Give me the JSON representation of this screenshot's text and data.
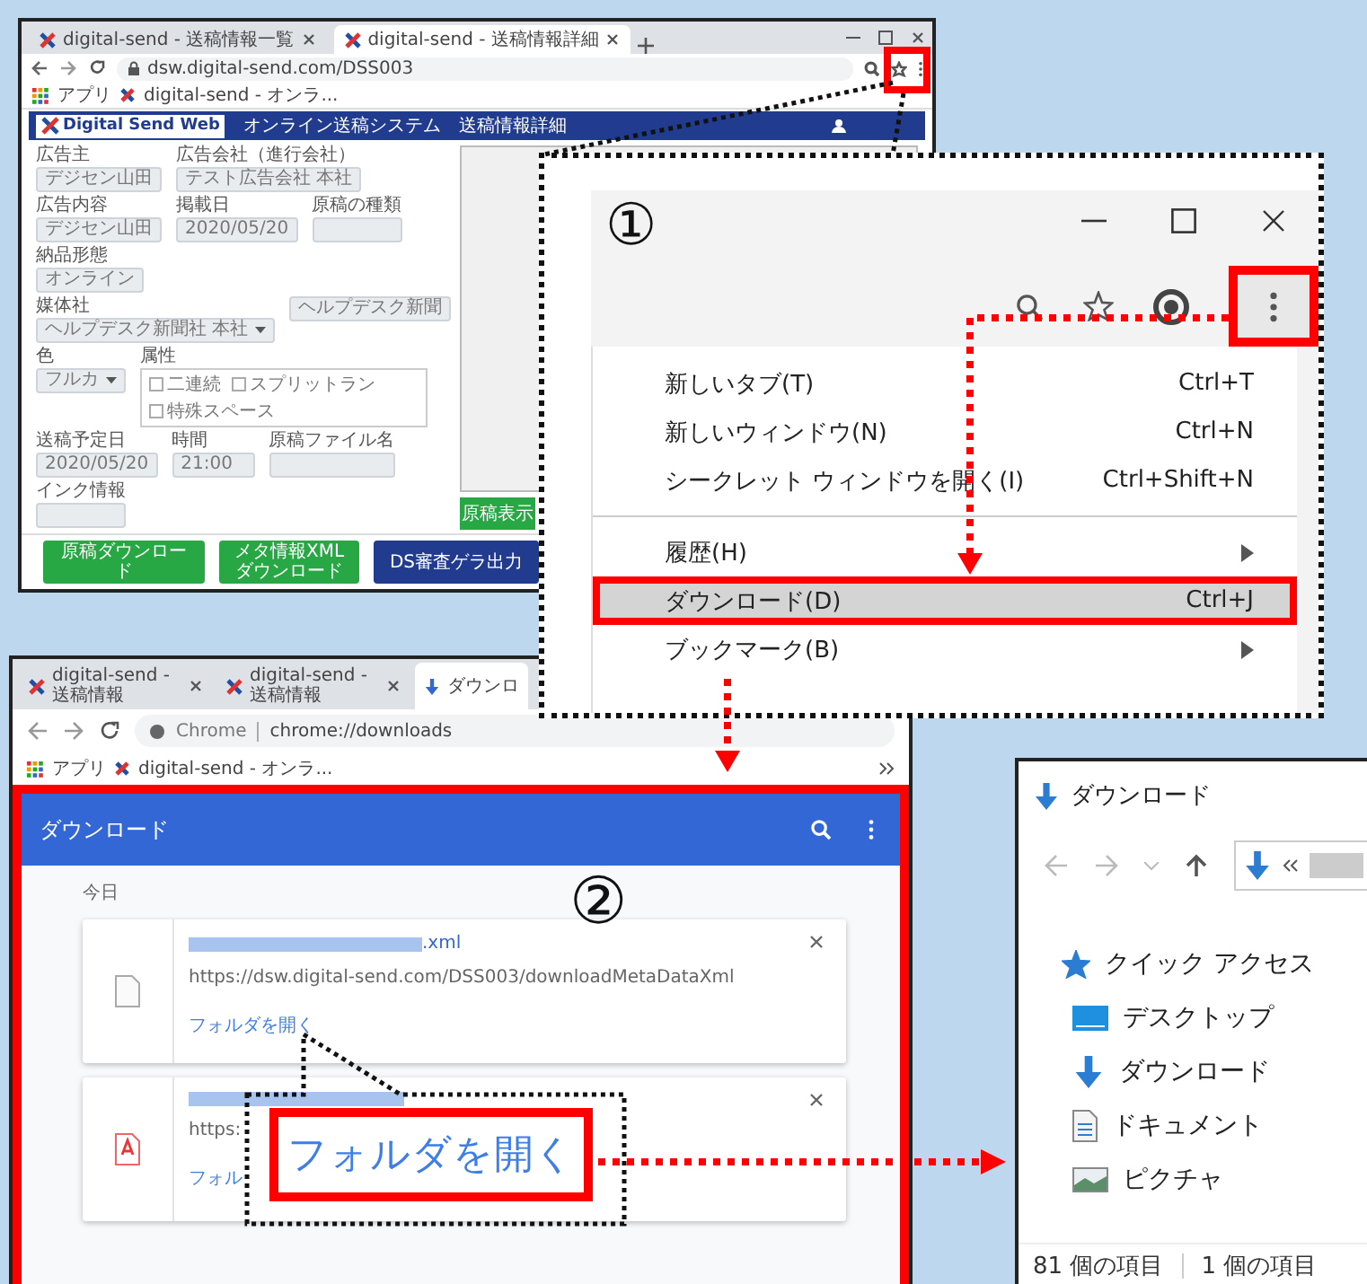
{
  "main_browser": {
    "tabs": [
      {
        "title": "digital-send - 送稿情報一覧",
        "selected": false
      },
      {
        "title": "digital-send - 送稿情報詳細",
        "selected": true
      }
    ],
    "url": "dsw.digital-send.com/DSS003",
    "bookmarks": [
      "アプリ",
      "digital-send - オンラ..."
    ],
    "app_bar": {
      "logo": "Digital Send Web",
      "items": [
        "オンライン送稿システム",
        "送稿情報詳細"
      ]
    },
    "form_rows": [
      [
        {
          "kind": "text",
          "label": "広告主",
          "value": "デジセン山田"
        },
        {
          "kind": "text",
          "label": "広告会社（進行会社）",
          "value": "テスト広告会社 本社"
        }
      ],
      [
        {
          "kind": "text",
          "label": "広告内容",
          "value": "デジセン山田"
        },
        {
          "kind": "text",
          "label": "掲載日",
          "value": "2020/05/20"
        },
        {
          "kind": "text",
          "label": "原稿の種類"
        },
        {
          "kind": "text",
          "label": "納品形態",
          "value": "オンライン"
        }
      ],
      [
        {
          "kind": "select",
          "label": "媒体社",
          "value": "ヘルプデスク新聞社 本社"
        },
        {
          "kind": "text",
          "value": "ヘルプデスク新聞"
        }
      ],
      [
        {
          "kind": "select",
          "label": "色",
          "value": "フルカ"
        },
        {
          "kind": "checks",
          "label": "属性",
          "options": [
            {
              "label": "二連続",
              "checked": false
            },
            {
              "label": "スプリットラン",
              "checked": false
            },
            {
              "label": "特殊スペース",
              "checked": false
            }
          ]
        }
      ],
      [
        {
          "kind": "text",
          "label": "送稿予定日",
          "value": "2020/05/20"
        },
        {
          "kind": "text",
          "label": "時間",
          "value": "21:00"
        },
        {
          "kind": "text",
          "label": "原稿ファイル名"
        }
      ],
      [
        {
          "kind": "text",
          "label": "インク情報"
        }
      ]
    ],
    "preview_button": "原稿表示",
    "buttons": [
      {
        "label": "原稿ダウンロード",
        "kind": "success"
      },
      {
        "label": "メタ情報XMLダウンロード",
        "kind": "success"
      },
      {
        "label": "DS審査ゲラ出力",
        "kind": "primary"
      }
    ]
  },
  "menu_zoom": {
    "step": "①",
    "menu_items": [
      {
        "kind": "item",
        "label": "新しいタブ(T)",
        "shortcut": "Ctrl+T",
        "selected": false
      },
      {
        "kind": "item",
        "label": "新しいウィンドウ(N)",
        "shortcut": "Ctrl+N",
        "selected": false
      },
      {
        "kind": "item",
        "label": "シークレット ウィンドウを開く(I)",
        "shortcut": "Ctrl+Shift+N",
        "selected": false
      },
      {
        "kind": "separator"
      },
      {
        "kind": "submenu",
        "label": "履歴(H)",
        "selected": false
      },
      {
        "kind": "item",
        "label": "ダウンロード(D)",
        "shortcut": "Ctrl+J",
        "selected": true
      },
      {
        "kind": "submenu",
        "label": "ブックマーク(B)",
        "selected": false
      }
    ]
  },
  "downloads_browser": {
    "tabs": [
      {
        "title": "digital-send - 送稿情報",
        "kind": "site",
        "selected": false
      },
      {
        "title": "digital-send - 送稿情報",
        "kind": "site",
        "selected": false
      },
      {
        "title": "ダウンロ",
        "kind": "downloads",
        "selected": true
      }
    ],
    "omnibox_label": "Chrome",
    "url": "chrome://downloads",
    "bookmarks": [
      "アプリ",
      "digital-send - オンラ..."
    ],
    "header": "ダウンロード",
    "step": "②",
    "section": "今日",
    "items": [
      {
        "kind": "document",
        "name": ".xml",
        "url": "https://dsw.digital-send.com/DSS003/downloadMetaDataXml",
        "action": "フォルダを開く"
      },
      {
        "kind": "pdf",
        "url": "https:",
        "action": "フォル"
      }
    ]
  },
  "callout": {
    "label": "フォルダを開く"
  },
  "explorer": {
    "title": "ダウンロード",
    "nav_items": [
      {
        "kind": "quick-access",
        "label": "クイック アクセス"
      },
      {
        "kind": "desktop",
        "label": "デスクトップ"
      },
      {
        "kind": "downloads",
        "label": "ダウンロード"
      },
      {
        "kind": "documents",
        "label": "ドキュメント"
      },
      {
        "kind": "pictures",
        "label": "ピクチャ"
      }
    ],
    "status": [
      "81 個の項目",
      "1 個の項目"
    ]
  }
}
